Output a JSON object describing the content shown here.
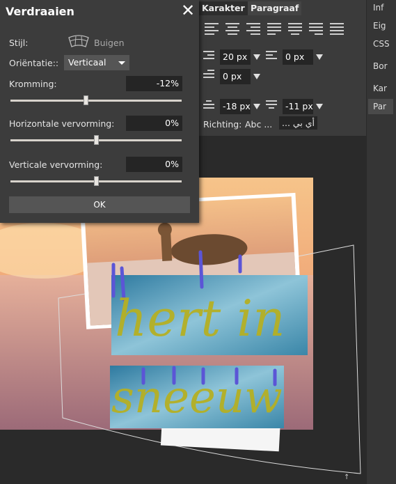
{
  "dialog": {
    "title": "Verdraaien",
    "style_label": "Stijl:",
    "style_value": "Buigen",
    "orientation_label": "Oriëntatie::",
    "orientation_value": "Verticaal",
    "curvature_label": "Kromming:",
    "curvature_value": "-12%",
    "curvature_level": 0.44,
    "hdist_label": "Horizontale vervorming:",
    "hdist_value": "0%",
    "hdist_level": 0.5,
    "vdist_label": "Verticale vervorming:",
    "vdist_value": "0%",
    "vdist_level": 0.5,
    "ok_label": "OK"
  },
  "panel": {
    "tabs": [
      "Karakter",
      "Paragraaf"
    ],
    "active_tab": "Paragraaf",
    "indent_left": "20 px",
    "indent_right": "0 px",
    "indent_first": "0 px",
    "space_before": "-18 px",
    "space_after": "-11 px",
    "direction_label": "Richting:",
    "direction_ltr": "Abc ...",
    "direction_rtl": "... أي بي"
  },
  "side_tabs": [
    "Inf",
    "Eig",
    "CSS",
    "Bor",
    "Kar",
    "Par"
  ],
  "side_tab_selected": "Par",
  "colors": {
    "dialog_bg": "#3c3c3c",
    "panel_bg": "#3b3b3b",
    "workspace_bg": "#2a2a2a",
    "text_yellow": "#b5b024",
    "clip_blue": "#5b55d6"
  },
  "canvas_text": {
    "line1": "hert in",
    "line2": "sneeuw"
  }
}
